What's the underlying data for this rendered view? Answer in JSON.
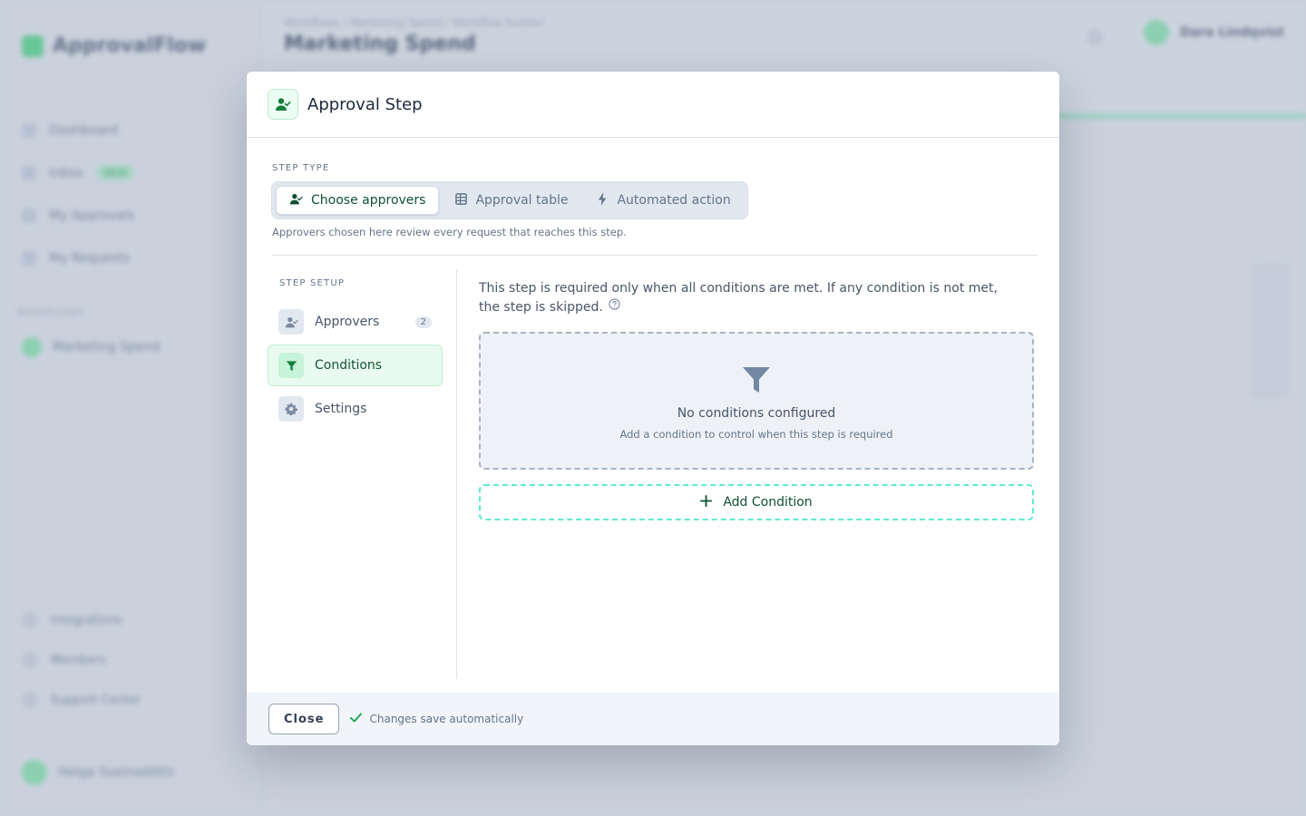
{
  "background": {
    "app_name": "ApprovalFlow",
    "nav": [
      {
        "label": "Dashboard"
      },
      {
        "label": "Inbox",
        "badge": "NEW"
      },
      {
        "label": "My Approvals"
      },
      {
        "label": "My Requests"
      }
    ],
    "section_label": "WORKFLOWS",
    "workspace": "Marketing Spend",
    "bottom_nav": [
      "Integrations",
      "Members",
      "Support Center"
    ],
    "user_footer": "Helga Sveinsdóttir",
    "breadcrumb": "Workflows  /  Marketing Spend  /  Workflow builder",
    "page_title": "Marketing Spend",
    "user_name": "Dara Lindqvist"
  },
  "modal": {
    "title": "Approval Step",
    "step_type_label": "STEP TYPE",
    "step_types": [
      {
        "label": "Choose approvers",
        "active": true,
        "icon": "user-check-icon"
      },
      {
        "label": "Approval table",
        "active": false,
        "icon": "table-icon"
      },
      {
        "label": "Automated action",
        "active": false,
        "icon": "bolt-icon"
      }
    ],
    "step_type_hint": "Approvers chosen here review every request that reaches this step.",
    "setup_label": "STEP SETUP",
    "setup_items": [
      {
        "label": "Approvers",
        "count": "2",
        "active": false,
        "icon": "user-check-icon"
      },
      {
        "label": "Conditions",
        "count": "",
        "active": true,
        "icon": "filter-icon"
      },
      {
        "label": "Settings",
        "count": "",
        "active": false,
        "icon": "gear-icon"
      }
    ],
    "conditions": {
      "description": "This step is required only when all conditions are met. If any condition is not met, the step is skipped.",
      "empty_title": "No conditions configured",
      "empty_subtitle": "Add a condition to control when this step is required",
      "add_label": "Add Condition"
    },
    "footer": {
      "close_label": "Close",
      "saved_note": "Changes save automatically"
    }
  },
  "colors": {
    "accent": "#0f5132",
    "accent_light": "#e9fbf0",
    "dashed_accent": "#5eead4",
    "muted": "#64748b"
  }
}
